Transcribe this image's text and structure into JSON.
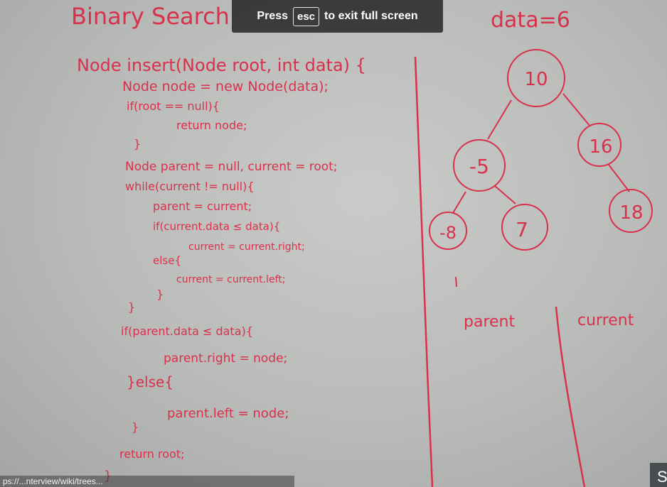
{
  "banner": {
    "press": "Press",
    "key": "esc",
    "suffix": "to exit full screen"
  },
  "board": {
    "title": "Binary Search",
    "top_right": "data=6",
    "code": [
      "Node insert(Node root, int data) {",
      "Node node = new Node(data);",
      "if(root == null){",
      "return node;",
      "}",
      "Node parent = null, current = root;",
      "while(current != null){",
      "parent = current;",
      "if(current.data ≤ data){",
      "current = current.right;",
      "else{",
      "current = current.left;",
      "}",
      "}",
      "if(parent.data ≤ data){",
      "parent.right = node;",
      "}else{",
      "parent.left = node;",
      "}",
      "return root;",
      "}"
    ],
    "tree_nodes": [
      "10",
      "-5",
      "16",
      "-8",
      "7",
      "18"
    ],
    "labels": {
      "parent": "parent",
      "current": "current"
    }
  },
  "status_url": "ps://...nterview/wiki/trees...",
  "corner_text": "S",
  "colors": {
    "ink": "#d8314c",
    "banner_bg": "#303030"
  }
}
